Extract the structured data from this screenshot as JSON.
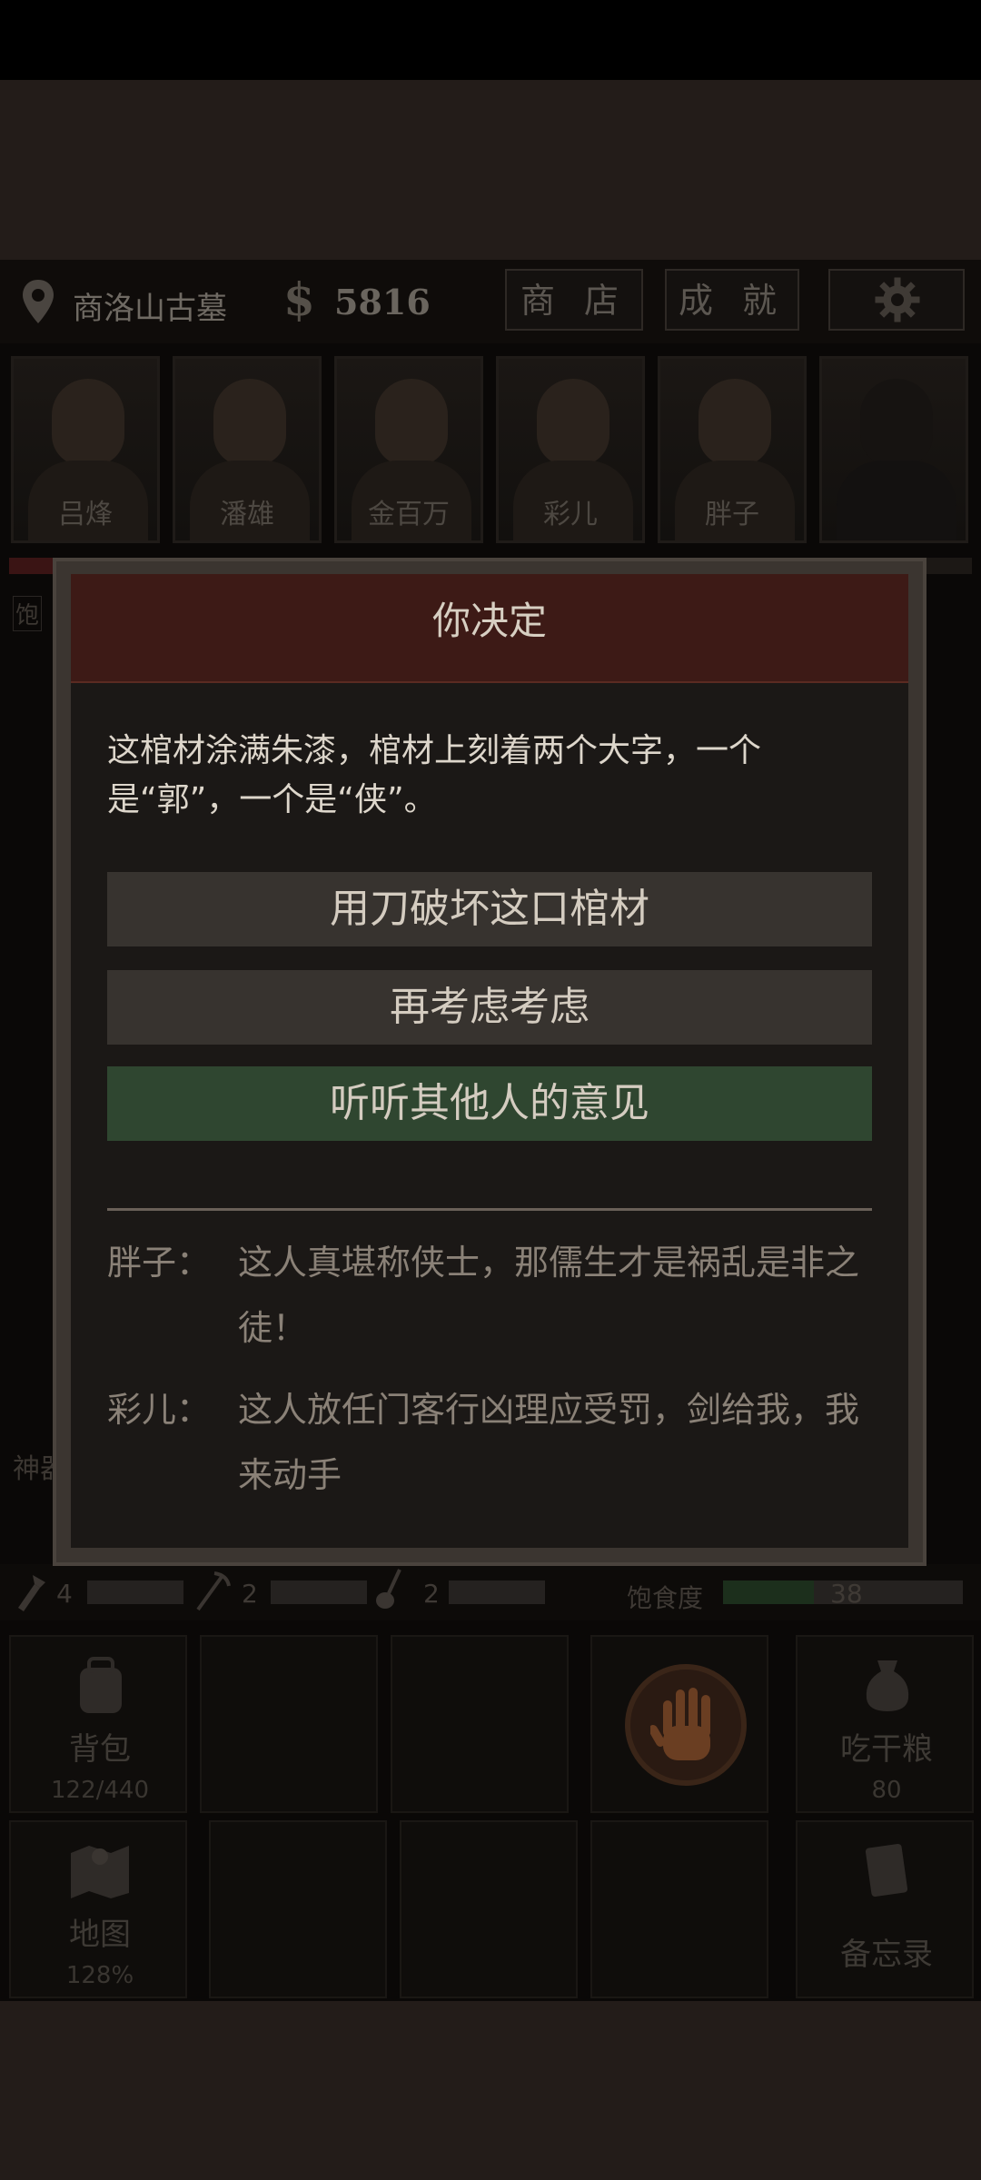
{
  "header": {
    "location": "商洛山古墓",
    "currency_symbol": "$",
    "money": "5816",
    "shop_label": "商 店",
    "achievements_label": "成 就",
    "settings_icon": "gear-icon",
    "location_icon": "map-pin-icon"
  },
  "party": [
    {
      "name": "吕烽"
    },
    {
      "name": "潘雄"
    },
    {
      "name": "金百万"
    },
    {
      "name": "彩儿"
    },
    {
      "name": "胖子"
    },
    {
      "name": ""
    }
  ],
  "side_labels": {
    "left_top": "饱",
    "left_mid": "神器"
  },
  "stats": {
    "tool1_value": "4",
    "tool2_value": "2",
    "tool3_value": "2",
    "satiety_label": "饱食度",
    "satiety_value": "38"
  },
  "actions": {
    "backpack_label": "背包",
    "backpack_sub": "122/440",
    "eat_label": "吃干粮",
    "eat_sub": "80",
    "map_label": "地图",
    "map_sub": "128%",
    "memo_label": "备忘录"
  },
  "dialog": {
    "title": "你决定",
    "text": "这棺材涂满朱漆，棺材上刻着两个大字，一个是“郭”，一个是“侠”。",
    "choices": [
      {
        "label": "用刀破坏这口棺材"
      },
      {
        "label": "再考虑考虑"
      },
      {
        "label": "听听其他人的意见"
      }
    ],
    "comments": [
      {
        "who": "胖子：",
        "what": "这人真堪称侠士，那儒生才是祸乱是非之徒！"
      },
      {
        "who": "彩儿：",
        "what": "这人放任门客行凶理应受罚，剑给我，我来动手"
      }
    ]
  },
  "colors": {
    "title_bar": "#3d1a16",
    "choice_default": "#37332f",
    "choice_highlight": "#2f4630"
  }
}
